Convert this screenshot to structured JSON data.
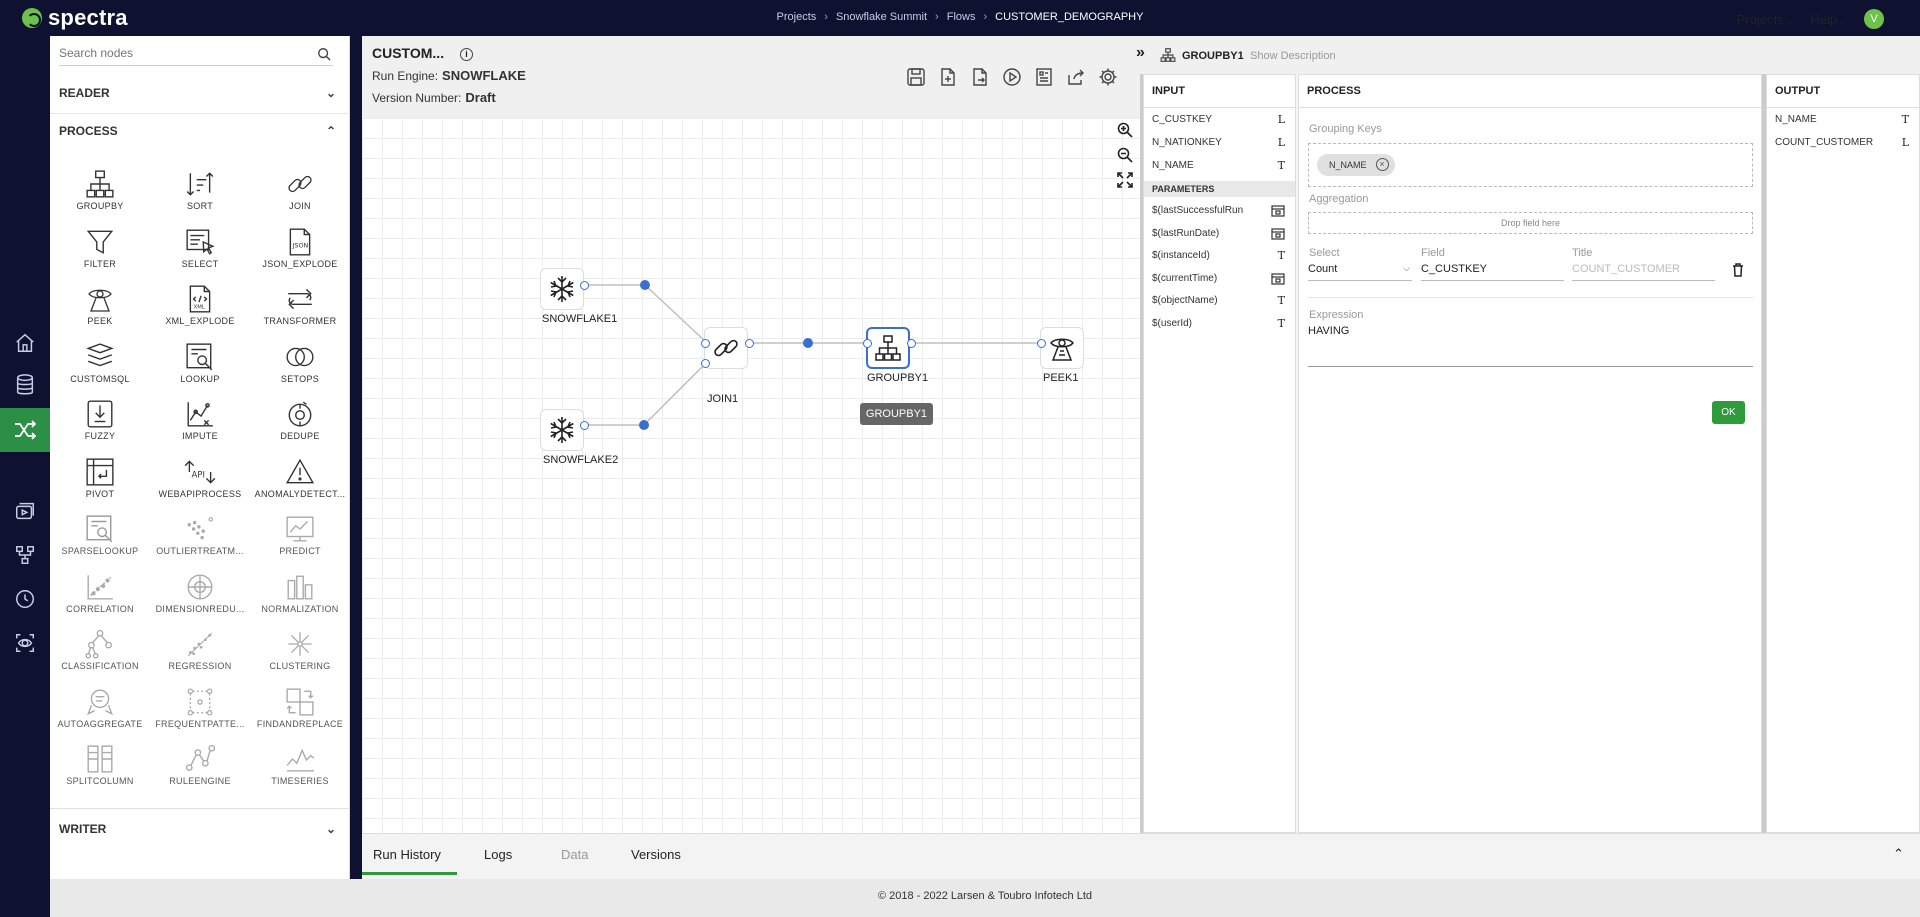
{
  "app": {
    "brand": "spectra",
    "accent_color": "#6cc24a",
    "nav_bg": "#0e1230",
    "breadcrumb": [
      "Projects",
      "Snowflake Summit",
      "Flows",
      "CUSTOMER_DEMOGRAPHY"
    ],
    "projects_menu": "Projects",
    "help_menu": "Help",
    "avatar_initial": "V"
  },
  "rail": {
    "icons": [
      "home-icon",
      "database-icon",
      "flows-icon",
      "media-icon",
      "pipeline-icon",
      "history-icon",
      "monitor-icon"
    ],
    "active_index": 2
  },
  "palette": {
    "search_placeholder": "Search nodes",
    "sections": {
      "reader": "READER",
      "process": "PROCESS",
      "writer": "WRITER"
    },
    "nodes": [
      "GROUPBY",
      "SORT",
      "JOIN",
      "FILTER",
      "SELECT",
      "JSON_EXPLODE",
      "PEEK",
      "XML_EXPLODE",
      "TRANSFORMER",
      "CUSTOMSQL",
      "LOOKUP",
      "SETOPS",
      "FUZZY",
      "IMPUTE",
      "DEDUPE",
      "PIVOT",
      "WEBAPIPROCESS",
      "ANOMALYDETECT...",
      "SPARSELOOKUP",
      "OUTLIERTREATM...",
      "PREDICT",
      "CORRELATION",
      "DIMENSIONREDU...",
      "NORMALIZATION",
      "CLASSIFICATION",
      "REGRESSION",
      "CLUSTERING",
      "AUTOAGGREGATE",
      "FREQUENTPATTE...",
      "FINDANDREPLACE",
      "SPLITCOLUMN",
      "RULEENGINE",
      "TIMESERIES"
    ],
    "dim_from_index": 18,
    "json_icon_text": "JSON",
    "xml_icon_text": "XML",
    "api_icon_text": "API"
  },
  "editor": {
    "flow_name": "CUSTOM...",
    "run_engine_label": "Run Engine:",
    "run_engine_value": "SNOWFLAKE",
    "version_label": "Version Number:",
    "version_value": "Draft",
    "nodes": {
      "snowflake1": "SNOWFLAKE1",
      "snowflake2": "SNOWFLAKE2",
      "join1": "JOIN1",
      "groupby1": "GROUPBY1",
      "peek1": "PEEK1"
    },
    "tooltip": "GROUPBY1"
  },
  "config": {
    "node_name": "GROUPBY1",
    "show_description": "Show Description",
    "input": {
      "title": "INPUT",
      "fields": [
        {
          "name": "C_CUSTKEY",
          "type": "L"
        },
        {
          "name": "N_NATIONKEY",
          "type": "L"
        },
        {
          "name": "N_NAME",
          "type": "T"
        }
      ],
      "params_title": "PARAMETERS",
      "params": [
        {
          "name": "$(lastSuccessfulRun",
          "type": "cal"
        },
        {
          "name": "$(lastRunDate)",
          "type": "cal"
        },
        {
          "name": "$(instanceId)",
          "type": "T"
        },
        {
          "name": "$(currentTime)",
          "type": "cal"
        },
        {
          "name": "$(objectName)",
          "type": "T"
        },
        {
          "name": "$(userId)",
          "type": "T"
        }
      ]
    },
    "process": {
      "title": "PROCESS",
      "grouping_keys_label": "Grouping Keys",
      "grouping_chip": "N_NAME",
      "aggregation_label": "Aggregation",
      "drop_hint": "Drop field here",
      "select_label": "Select",
      "select_value": "Count",
      "field_label": "Field",
      "field_value": "C_CUSTKEY",
      "title_label": "Title",
      "title_placeholder": "COUNT_CUSTOMER",
      "expression_label": "Expression",
      "expression_value": "HAVING",
      "ok_label": "OK"
    },
    "output": {
      "title": "OUTPUT",
      "fields": [
        {
          "name": "N_NAME",
          "type": "T"
        },
        {
          "name": "COUNT_CUSTOMER",
          "type": "L"
        }
      ]
    }
  },
  "bottom_tabs": [
    "Run History",
    "Logs",
    "Data",
    "Versions"
  ],
  "active_tab": "Run History",
  "footer": "© 2018 - 2022 Larsen & Toubro Infotech Ltd"
}
